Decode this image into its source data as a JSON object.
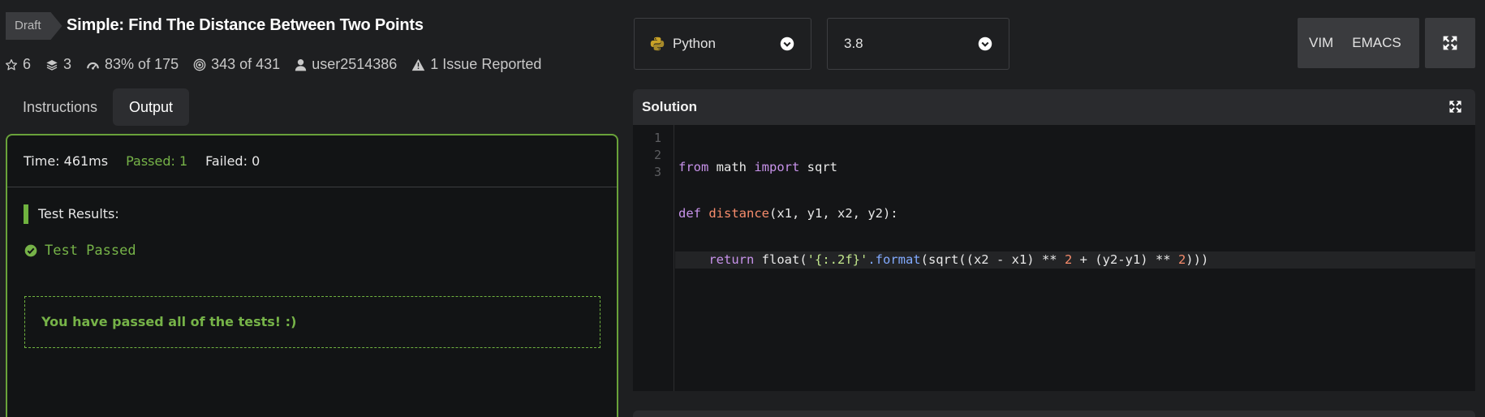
{
  "kata": {
    "badge": "Draft",
    "title": "Simple: Find The Distance Between Two Points",
    "stats": {
      "stars": "6",
      "collections": "3",
      "satisfaction": "83% of 175",
      "completed": "343 of 431",
      "author": "user2514386",
      "issues": "1 Issue Reported"
    }
  },
  "tabs": [
    {
      "label": "Instructions",
      "active": false
    },
    {
      "label": "Output",
      "active": true
    }
  ],
  "output": {
    "time": "Time: 461ms",
    "passed": "Passed: 1",
    "failed": "Failed: 0",
    "results_heading": "Test Results:",
    "test_status": "Test Passed",
    "success_message": "You have passed all of the tests! :)"
  },
  "language": {
    "selected": "Python",
    "icon": "python-icon"
  },
  "version": {
    "selected": "3.8"
  },
  "editor_modes": {
    "vim": "VIM",
    "emacs": "EMACS"
  },
  "solution": {
    "title": "Solution",
    "line_numbers": [
      "1",
      "2",
      "3"
    ],
    "code": {
      "line1": {
        "kw1": "from",
        "mod": " math ",
        "kw2": "import",
        "name": " sqrt"
      },
      "line2": {
        "kw": "def",
        "space": " ",
        "fn": "distance",
        "args": "(x1, y1, x2, y2):"
      },
      "line3": {
        "indent": "    ",
        "kw": "return",
        "t1": " float(",
        "str": "'{:.2f}'",
        "meth": ".format",
        "t2": "(sqrt((x2 - x1) ** ",
        "n1": "2",
        "t3": " + (y2-y1) ** ",
        "n2": "2",
        "t4": ")))"
      }
    }
  },
  "colors": {
    "success": "#76b348",
    "border_success": "#69a23a",
    "background": "#1e1f21"
  }
}
